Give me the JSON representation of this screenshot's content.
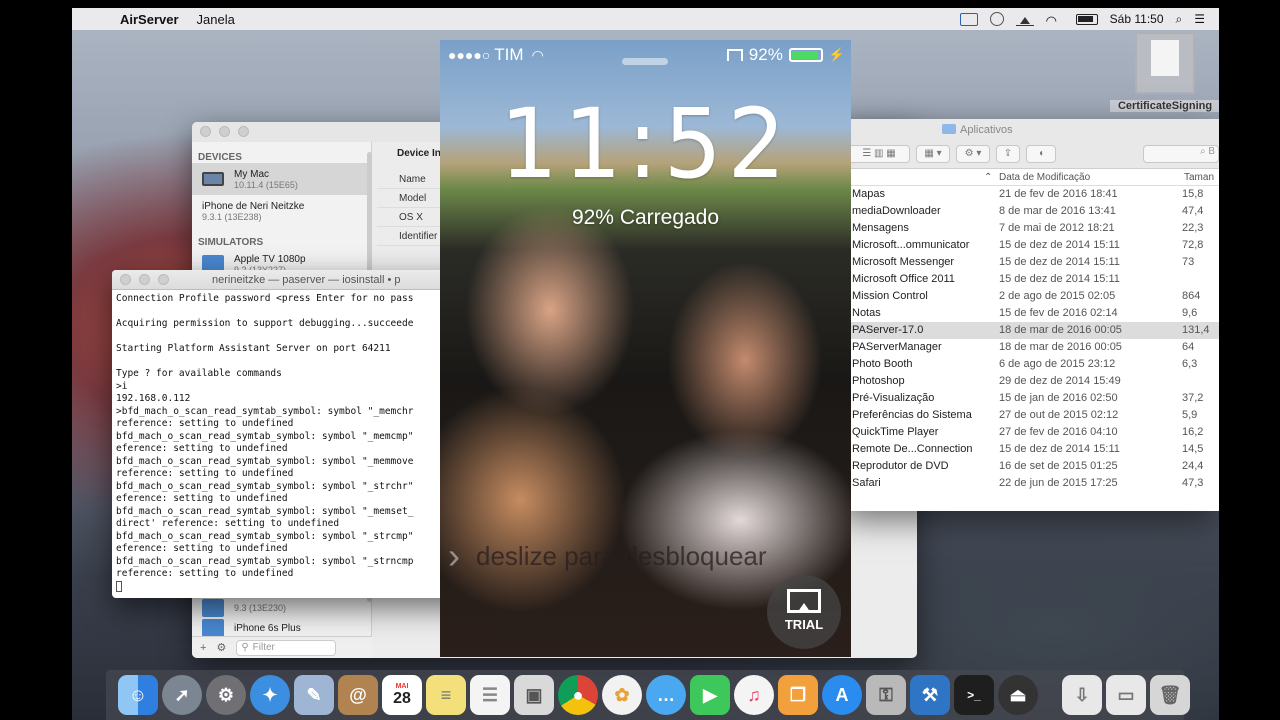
{
  "menubar": {
    "app_name": "AirServer",
    "menu_window": "Janela",
    "clock": "Sáb 11:50",
    "icons": [
      "apple-icon",
      "airserver-status-icon",
      "sync-icon",
      "airplay-icon",
      "wifi-icon",
      "battery-icon",
      "search-icon",
      "list-icon"
    ]
  },
  "devices_window": {
    "devices_header": "DEVICES",
    "my_mac_name": "My Mac",
    "my_mac_version": "10.11.4 (15E65)",
    "iphone_name": "iPhone de Neri Neitzke",
    "iphone_version": "9.3.1 (13E238)",
    "simulators_header": "SIMULATORS",
    "apple_tv_name": "Apple TV 1080p",
    "apple_tv_version": "9.2 (13Y227)",
    "sim_version": "9.3 (13E230)",
    "iphone6s_plus": "iPhone 6s Plus",
    "iphone6s_plus_version": "9.3 (13E230)",
    "info_title": "Device In",
    "info_rows": [
      "Name",
      "Model",
      "OS X",
      "Identifier"
    ],
    "filter_placeholder": "Filter"
  },
  "terminal": {
    "title": "nerineitzke — paserver — iosinstall • p",
    "lines": [
      "Connection Profile password <press Enter for no pass",
      "",
      "Acquiring permission to support debugging...succeede",
      "",
      "Starting Platform Assistant Server on port 64211",
      "",
      "Type ? for available commands",
      ">i",
      "192.168.0.112",
      ">bfd_mach_o_scan_read_symtab_symbol: symbol \"_memchr",
      "reference: setting to undefined",
      "bfd_mach_o_scan_read_symtab_symbol: symbol \"_memcmp\"",
      "eference: setting to undefined",
      "bfd_mach_o_scan_read_symtab_symbol: symbol \"_memmove",
      "reference: setting to undefined",
      "bfd_mach_o_scan_read_symtab_symbol: symbol \"_strchr\"",
      "eference: setting to undefined",
      "bfd_mach_o_scan_read_symtab_symbol: symbol \"_memset_",
      "direct' reference: setting to undefined",
      "bfd_mach_o_scan_read_symtab_symbol: symbol \"_strcmp\"",
      "eference: setting to undefined",
      "bfd_mach_o_scan_read_symtab_symbol: symbol \"_strncmp",
      "reference: setting to undefined"
    ]
  },
  "finder": {
    "title": "Aplicativos",
    "search_placeholder": "B",
    "col_date": "Data de Modificação",
    "col_size": "Taman",
    "rows": [
      {
        "name": "Mapas",
        "date": "21 de fev de 2016 18:41",
        "size": "15,8"
      },
      {
        "name": "mediaDownloader",
        "date": "8 de mar de 2016 13:41",
        "size": "47,4"
      },
      {
        "name": "Mensagens",
        "date": "7 de mai de 2012 18:21",
        "size": "22,3"
      },
      {
        "name": "Microsoft...ommunicator",
        "date": "15 de dez de 2014 15:11",
        "size": "72,8"
      },
      {
        "name": "Microsoft Messenger",
        "date": "15 de dez de 2014 15:11",
        "size": "73"
      },
      {
        "name": "Microsoft Office 2011",
        "date": "15 de dez de 2014 15:11",
        "size": ""
      },
      {
        "name": "Mission Control",
        "date": "2 de ago de 2015 02:05",
        "size": "864"
      },
      {
        "name": "Notas",
        "date": "15 de fev de 2016 02:14",
        "size": "9,6"
      },
      {
        "name": "PAServer-17.0",
        "date": "18 de mar de 2016 00:05",
        "size": "131,4"
      },
      {
        "name": "PAServerManager",
        "date": "18 de mar de 2016 00:05",
        "size": "64"
      },
      {
        "name": "Photo Booth",
        "date": "6 de ago de 2015 23:12",
        "size": "6,3"
      },
      {
        "name": "Photoshop",
        "date": "29 de dez de 2014 15:49",
        "size": ""
      },
      {
        "name": "Pré-Visualização",
        "date": "15 de jan de 2016 02:50",
        "size": "37,2"
      },
      {
        "name": "Preferências do Sistema",
        "date": "27 de out de 2015 02:12",
        "size": "5,9"
      },
      {
        "name": "QuickTime Player",
        "date": "27 de fev de 2016 04:10",
        "size": "16,2"
      },
      {
        "name": "Remote De...Connection",
        "date": "15 de dez de 2014 15:11",
        "size": "14,5"
      },
      {
        "name": "Reprodutor de DVD",
        "date": "16 de set de 2015 01:25",
        "size": "24,4"
      },
      {
        "name": "Safari",
        "date": "22 de jun de 2015 17:25",
        "size": "47,3"
      }
    ]
  },
  "cert_file": {
    "label": "CertificateSigning"
  },
  "phone": {
    "carrier": "TIM",
    "battery_text": "92%",
    "battery_level": 0.92,
    "time": "11:52",
    "charging_text": "92% Carregado",
    "slide_text": "deslize para desbloquear",
    "trial_label": "TRIAL"
  },
  "dock": {
    "calendar_month": "MAI",
    "calendar_day": "28",
    "apps": [
      "finder-icon",
      "launchpad-icon",
      "system-preferences-icon",
      "safari-icon",
      "preview-icon",
      "contacts-icon",
      "calendar-icon",
      "notes-icon",
      "reminders-icon",
      "photo-booth-icon",
      "chrome-icon",
      "photos-icon",
      "messages-icon",
      "facetime-icon",
      "itunes-icon",
      "ibooks-icon",
      "app-store-icon",
      "keychain-icon",
      "xcode-icon",
      "terminal-icon",
      "airserver-icon",
      "downloads-icon",
      "documents-icon",
      "trash-icon"
    ]
  }
}
